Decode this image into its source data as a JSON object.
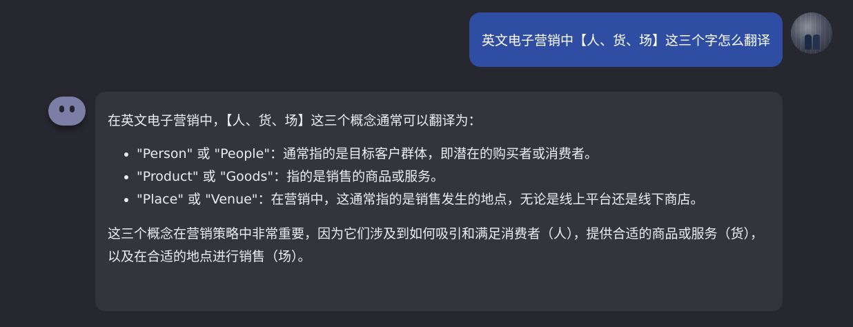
{
  "user_message": {
    "text": "英文电子营销中【人、货、场】这三个字怎么翻译"
  },
  "assistant_message": {
    "intro": "在英文电子营销中，【人、货、场】这三个概念通常可以翻译为：",
    "bullets": [
      "\"Person\" 或 \"People\"：通常指的是目标客户群体，即潜在的购买者或消费者。",
      "\"Product\" 或 \"Goods\"：指的是销售的商品或服务。",
      "\"Place\" 或 \"Venue\"：在营销中，这通常指的是销售发生的地点，无论是线上平台还是线下商店。"
    ],
    "conclusion": "这三个概念在营销策略中非常重要，因为它们涉及到如何吸引和满足消费者（人），提供合适的商品或服务（货），以及在合适的地点进行销售（场）。"
  },
  "colors": {
    "background": "#27272f",
    "user_bubble": "#2f4ea3",
    "assistant_bubble": "#34343d",
    "bot_avatar": "#7b7fa6"
  },
  "icons": {
    "user_avatar": "user-photo-avatar",
    "bot_avatar": "bot-face-icon"
  }
}
